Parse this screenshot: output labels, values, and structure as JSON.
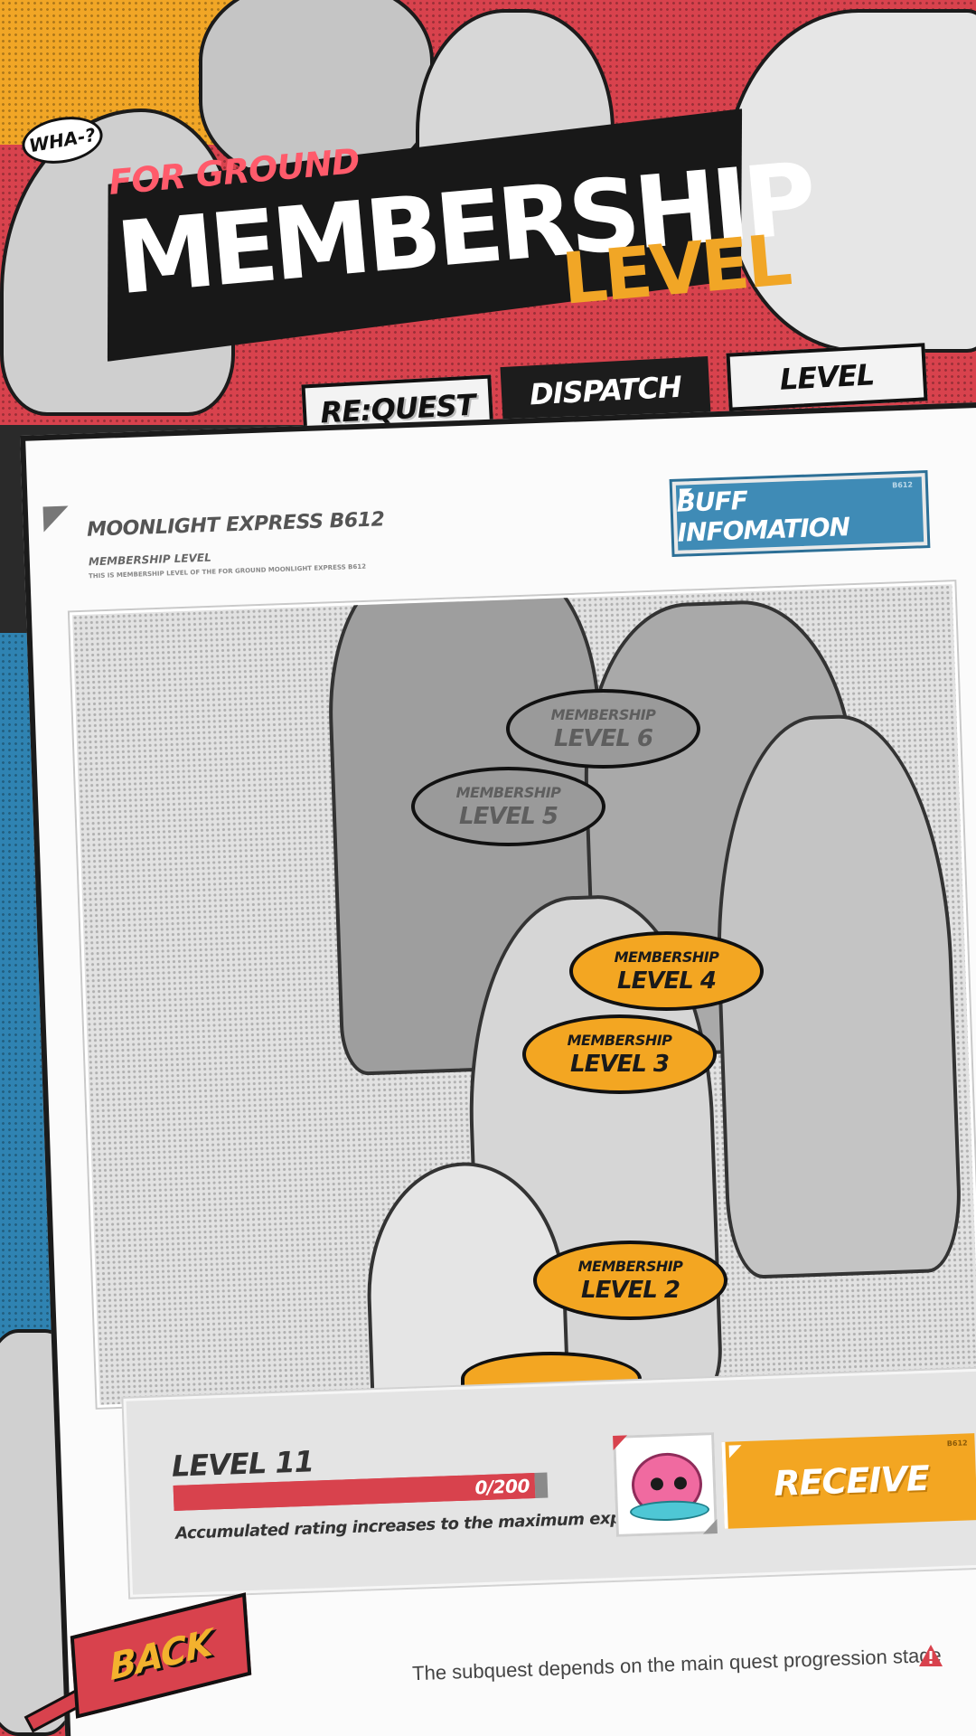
{
  "header": {
    "exclaim": "WHA-?",
    "subtitle": "FOR GROUND",
    "title": "MEMBERSHIP",
    "title_accent": "LEVEL"
  },
  "tabs": [
    {
      "label": "RE:QUEST",
      "active": false
    },
    {
      "label": "DISPATCH",
      "active": true
    },
    {
      "label": "LEVEL",
      "active": false
    }
  ],
  "panel": {
    "title": "MOONLIGHT EXPRESS B612",
    "subtitle": "MEMBERSHIP LEVEL",
    "description": "THIS IS MEMBERSHIP LEVEL OF THE FOR GROUND MOONLIGHT EXPRESS B612",
    "buff_button": {
      "label": "BUFF INFOMATION",
      "tag": "B612"
    }
  },
  "bubbles": [
    {
      "top": "MEMBERSHIP",
      "bottom": "LEVEL 6",
      "unlocked": false
    },
    {
      "top": "MEMBERSHIP",
      "bottom": "LEVEL 5",
      "unlocked": false
    },
    {
      "top": "MEMBERSHIP",
      "bottom": "LEVEL 4",
      "unlocked": true
    },
    {
      "top": "MEMBERSHIP",
      "bottom": "LEVEL 3",
      "unlocked": true
    },
    {
      "top": "MEMBERSHIP",
      "bottom": "LEVEL 2",
      "unlocked": true
    }
  ],
  "level": {
    "label": "LEVEL 11",
    "progress_text": "0/200",
    "progress_fraction": 1.0,
    "description": "Accumulated rating increases to the maximum experience"
  },
  "reward": {
    "icon": "pink-pufferfish-icon"
  },
  "receive_button": {
    "label": "RECEIVE",
    "tag": "B612"
  },
  "footer": {
    "back_label": "BACK",
    "notice": "The subquest depends on the main quest progression stage"
  },
  "colors": {
    "red": "#d8424d",
    "orange": "#f3a622",
    "blue": "#3f8bb6",
    "dark": "#1b1b1b"
  }
}
